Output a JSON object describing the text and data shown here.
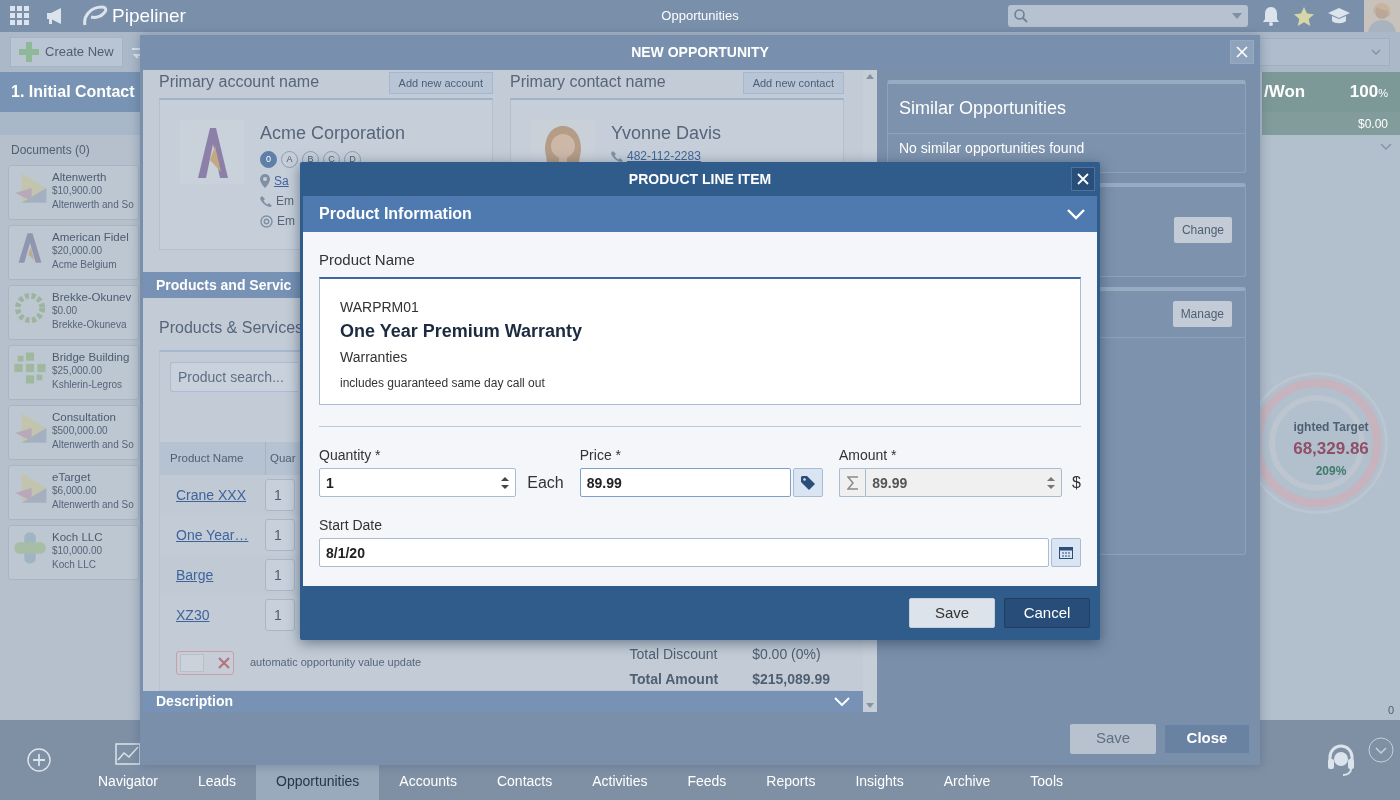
{
  "app": {
    "brand": "Pipeliner",
    "title": "Opportunities",
    "create_label": "Create New",
    "stage": "1. Initial Contact",
    "documents": "Documents (0)",
    "cards": [
      {
        "name": "Altenwerth",
        "amount": "$10,900.00",
        "account": "Altenwerth and So",
        "kind": "triangle"
      },
      {
        "name": "American Fidel",
        "amount": "$20,000.00",
        "account": "Acme Belgium",
        "kind": "letter"
      },
      {
        "name": "Brekke-Okunev",
        "amount": "$0.00",
        "account": "Brekke-Okuneva",
        "kind": "ring"
      },
      {
        "name": "Bridge Building",
        "amount": "$25,000.00",
        "account": "Kshlerin-Legros",
        "kind": "flower"
      },
      {
        "name": "Consultation",
        "amount": "$500,000.00",
        "account": "Altenwerth and So",
        "kind": "triangle"
      },
      {
        "name": "eTarget",
        "amount": "$6,000.00",
        "account": "Altenwerth and So",
        "kind": "triangle"
      },
      {
        "name": "Koch LLC",
        "amount": "$10,000.00",
        "account": "Koch LLC",
        "kind": "cross"
      }
    ],
    "won": {
      "label": "/Won",
      "percent": "100",
      "unit": "%",
      "amount": "$0.00",
      "count": "0"
    },
    "target": {
      "label": "ighted Target",
      "value": "68,329.86",
      "change": "209%"
    },
    "nav": [
      {
        "label": "Navigator",
        "selected": false
      },
      {
        "label": "Leads",
        "selected": false
      },
      {
        "label": "Opportunities",
        "selected": true
      },
      {
        "label": "Accounts",
        "selected": false
      },
      {
        "label": "Contacts",
        "selected": false
      },
      {
        "label": "Activities",
        "selected": false
      },
      {
        "label": "Feeds",
        "selected": false
      },
      {
        "label": "Reports",
        "selected": false
      },
      {
        "label": "Insights",
        "selected": false
      },
      {
        "label": "Archive",
        "selected": false
      },
      {
        "label": "Tools",
        "selected": false
      }
    ]
  },
  "opportunity_dialog": {
    "title": "NEW OPPORTUNITY",
    "account": {
      "label": "Primary account name",
      "button": "Add new account",
      "name": "Acme Corporation",
      "ratings": [
        {
          "label": "0",
          "selected": true
        },
        {
          "label": "A",
          "selected": false
        },
        {
          "label": "B",
          "selected": false
        },
        {
          "label": "C",
          "selected": false
        },
        {
          "label": "D",
          "selected": false
        }
      ],
      "lines": [
        {
          "kind": "address",
          "text": "Sa"
        },
        {
          "kind": "phone",
          "text": "Em"
        },
        {
          "kind": "email",
          "text": "Em"
        }
      ]
    },
    "contact": {
      "label": "Primary contact name",
      "button": "Add new contact",
      "name": "Yvonne Davis",
      "phone": "482-112-2283"
    },
    "products_section": "Products and Servic",
    "products": {
      "heading": "Products & Services",
      "search_placeholder": "Product search...",
      "columns": [
        "Product Name",
        "Quar"
      ],
      "rows": [
        {
          "name": "Crane XXX",
          "quantity": "1"
        },
        {
          "name": "One Year…",
          "quantity": "1"
        },
        {
          "name": "Barge",
          "quantity": "1"
        },
        {
          "name": "XZ30",
          "quantity": "1"
        }
      ],
      "auto_update": {
        "label": "automatic opportunity value update",
        "on": false
      },
      "totals": [
        {
          "label": "Total Discount",
          "value": "$0.00 (0%)",
          "bold": false
        },
        {
          "label": "Total Amount",
          "value": "$215,089.99",
          "bold": true
        }
      ]
    },
    "description_section": "Description",
    "similar": {
      "title": "Similar Opportunities",
      "message": "No similar opportunities found"
    },
    "panel_buttons": [
      "Change",
      "Manage"
    ],
    "buttons": [
      {
        "label": "Save",
        "disabled": true
      },
      {
        "label": "Close",
        "disabled": false
      }
    ]
  },
  "product_dialog": {
    "title": "PRODUCT LINE ITEM",
    "section": "Product Information",
    "expanded": true,
    "product_label": "Product Name",
    "product": {
      "code": "WARPRM01",
      "name": "One Year Premium Warranty",
      "category": "Warranties",
      "description": "includes guaranteed same day call out"
    },
    "quantity": {
      "label": "Quantity *",
      "value": "1",
      "unit": "Each"
    },
    "price": {
      "label": "Price *",
      "value": "89.99"
    },
    "amount": {
      "label": "Amount *",
      "value": "89.99",
      "currency": "$",
      "disabled": true
    },
    "start_date": {
      "label": "Start Date",
      "value": "8/1/20"
    },
    "buttons": [
      {
        "label": "Save",
        "kind": "secondary"
      },
      {
        "label": "Cancel",
        "kind": "primary"
      }
    ]
  }
}
